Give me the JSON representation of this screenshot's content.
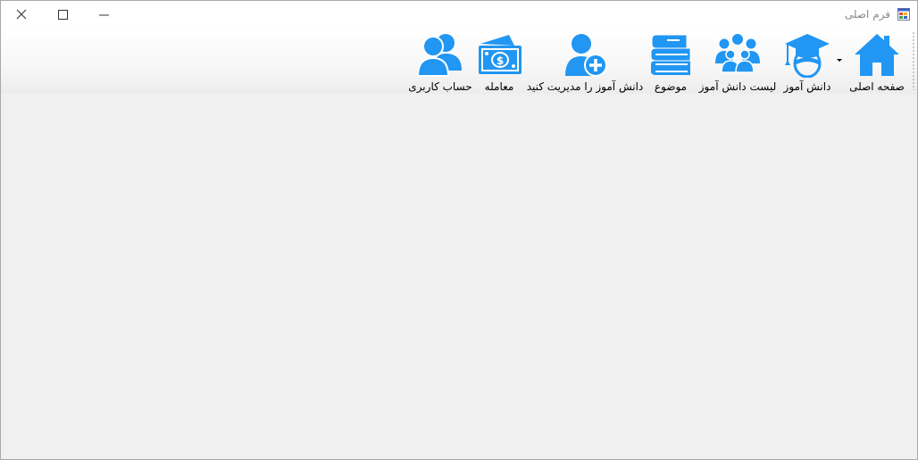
{
  "window": {
    "title": "فرم اصلی",
    "accent": "#2196f3"
  },
  "toolbar": {
    "items": [
      {
        "label": "صفحه اصلی",
        "icon": "home-icon"
      },
      {
        "label": "دانش آموز",
        "icon": "student-graduate-icon",
        "has_dropdown": true
      },
      {
        "label": "لیست دانش آموز",
        "icon": "group-users-icon"
      },
      {
        "label": "موضوع",
        "icon": "books-icon"
      },
      {
        "label": "دانش آموز را مدیریت کنید",
        "icon": "add-user-icon"
      },
      {
        "label": "معامله",
        "icon": "money-icon"
      },
      {
        "label": "حساب کاربری",
        "icon": "users-account-icon"
      }
    ]
  }
}
